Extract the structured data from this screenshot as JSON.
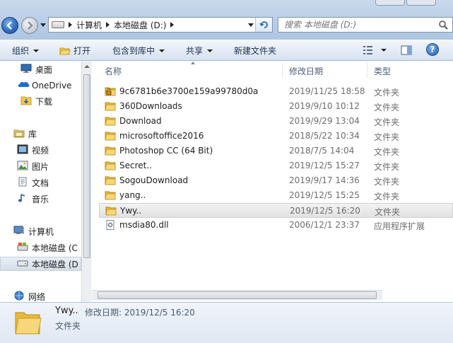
{
  "address": {
    "crumbs": [
      "计算机",
      "本地磁盘 (D:)"
    ]
  },
  "search": {
    "placeholder": "搜索 本地磁盘 (D:)"
  },
  "toolbar": {
    "organize": "组织",
    "open": "打开",
    "include_in_library": "包含到库中",
    "share": "共享",
    "new_folder": "新建文件夹"
  },
  "nav": {
    "items": [
      {
        "label": "桌面",
        "icon": "desktop-icon"
      },
      {
        "label": "OneDrive",
        "icon": "onedrive-icon"
      },
      {
        "label": "下载",
        "icon": "download-folder-icon"
      },
      {
        "label": "库",
        "icon": "library-icon"
      },
      {
        "label": "视频",
        "icon": "video-icon"
      },
      {
        "label": "图片",
        "icon": "picture-icon"
      },
      {
        "label": "文档",
        "icon": "document-icon"
      },
      {
        "label": "音乐",
        "icon": "music-icon"
      },
      {
        "label": "计算机",
        "icon": "computer-icon"
      },
      {
        "label": "本地磁盘 (C",
        "icon": "drive-icon"
      },
      {
        "label": "本地磁盘 (D",
        "icon": "drive-icon"
      },
      {
        "label": "网络",
        "icon": "network-icon"
      }
    ]
  },
  "columns": {
    "name": "名称",
    "modified": "修改日期",
    "type": "类型"
  },
  "files": [
    {
      "name": "9c6781b6e3700e159a99780d0a",
      "date": "2019/11/25 18:58",
      "type": "文件夹",
      "kind": "locked-folder"
    },
    {
      "name": "360Downloads",
      "date": "2019/9/10 10:12",
      "type": "文件夹",
      "kind": "folder"
    },
    {
      "name": "Download",
      "date": "2019/9/29 13:04",
      "type": "文件夹",
      "kind": "folder"
    },
    {
      "name": "microsoftoffice2016",
      "date": "2018/5/22 10:34",
      "type": "文件夹",
      "kind": "folder"
    },
    {
      "name": "Photoshop CC (64 Bit)",
      "date": "2018/7/5 14:04",
      "type": "文件夹",
      "kind": "folder"
    },
    {
      "name": "Secret..",
      "date": "2019/12/5 15:27",
      "type": "文件夹",
      "kind": "folder"
    },
    {
      "name": "SogouDownload",
      "date": "2019/9/17 14:36",
      "type": "文件夹",
      "kind": "folder"
    },
    {
      "name": "yang..",
      "date": "2019/12/5 15:25",
      "type": "文件夹",
      "kind": "folder"
    },
    {
      "name": "Ywy..",
      "date": "2019/12/5 16:20",
      "type": "文件夹",
      "kind": "folder"
    },
    {
      "name": "msdia80.dll",
      "date": "2006/12/1 23:37",
      "type": "应用程序扩展",
      "kind": "dll"
    }
  ],
  "details": {
    "name": "Ywy..",
    "modified_label": "修改日期: 2019/12/5 16:20",
    "type": "文件夹"
  },
  "colors": {
    "folder": "#f2c94c",
    "accent": "#2d6fc4"
  }
}
